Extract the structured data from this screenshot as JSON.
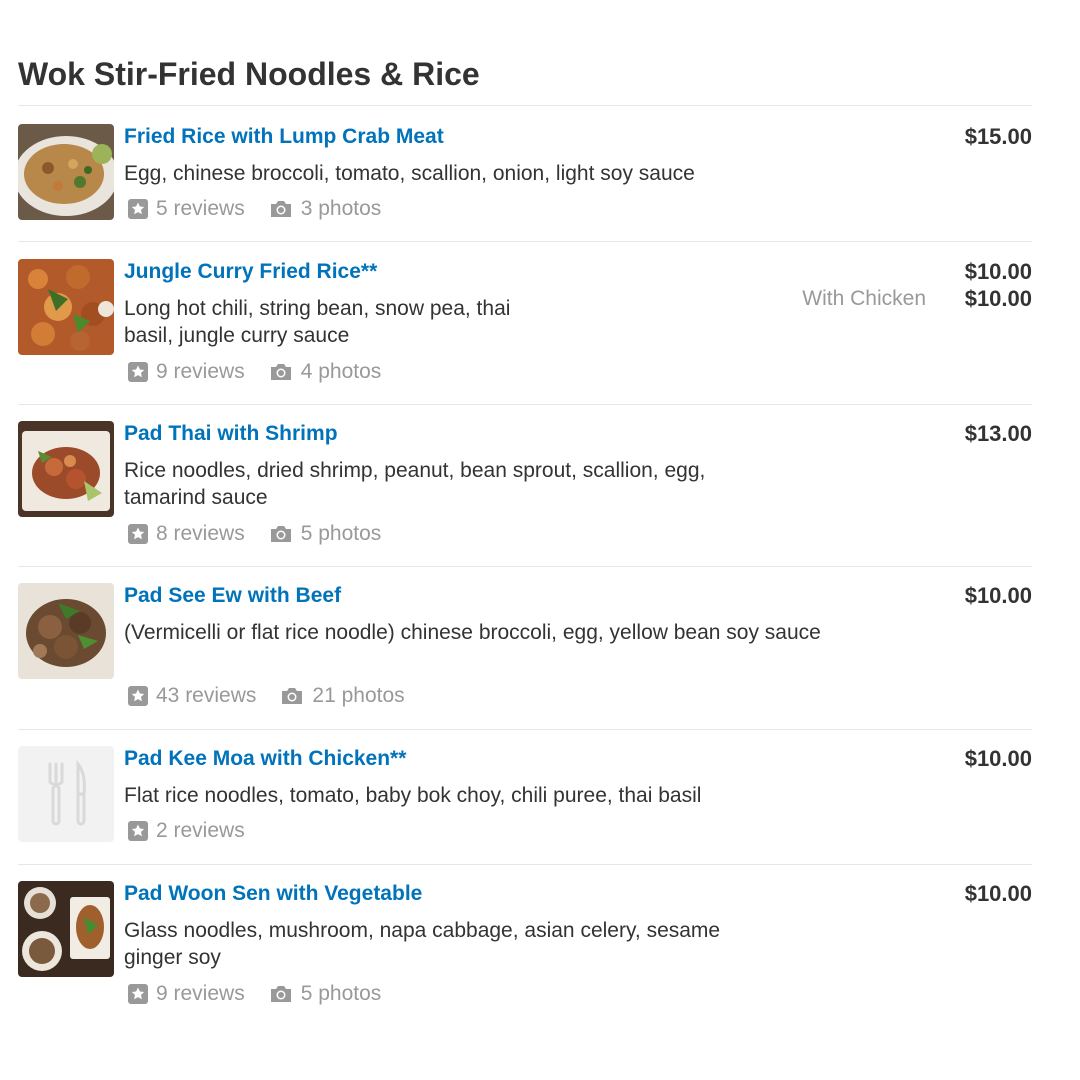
{
  "section": {
    "title": "Wok Stir-Fried Noodles & Rice"
  },
  "items": [
    {
      "name": "Fried Rice with Lump Crab Meat",
      "description": "Egg, chinese broccoli, tomato, scallion, onion, light soy sauce",
      "reviews": "5 reviews",
      "photos": "3 photos",
      "price": "$15.00"
    },
    {
      "name": "Jungle Curry Fried Rice**",
      "description": "Long hot chili, string bean, snow pea, thai basil, jungle curry sauce",
      "reviews": "9 reviews",
      "photos": "4 photos",
      "price": "$10.00",
      "option_label": "With Chicken",
      "option_price": "$10.00"
    },
    {
      "name": "Pad Thai with Shrimp",
      "description": "Rice noodles, dried shrimp, peanut, bean sprout, scallion, egg, tamarind sauce",
      "reviews": "8 reviews",
      "photos": "5 photos",
      "price": "$13.00"
    },
    {
      "name": "Pad See Ew with Beef",
      "description": "(Vermicelli or flat rice noodle) chinese broccoli, egg, yellow bean soy sauce",
      "reviews": "43 reviews",
      "photos": "21 photos",
      "price": "$10.00"
    },
    {
      "name": "Pad Kee Moa with Chicken**",
      "description": "Flat rice noodles, tomato, baby bok choy, chili puree, thai basil",
      "reviews": "2 reviews",
      "price": "$10.00"
    },
    {
      "name": "Pad Woon Sen with Vegetable",
      "description": "Glass noodles, mushroom, napa cabbage, asian celery, sesame ginger soy",
      "reviews": "9 reviews",
      "photos": "5 photos",
      "price": "$10.00"
    }
  ],
  "icons": {
    "reviews": "star-icon",
    "photos": "camera-icon",
    "placeholder": "fork-knife-icon"
  },
  "colors": {
    "link": "#0073bb",
    "text": "#333333",
    "muted": "#999999",
    "divider": "#e6e6e6"
  }
}
